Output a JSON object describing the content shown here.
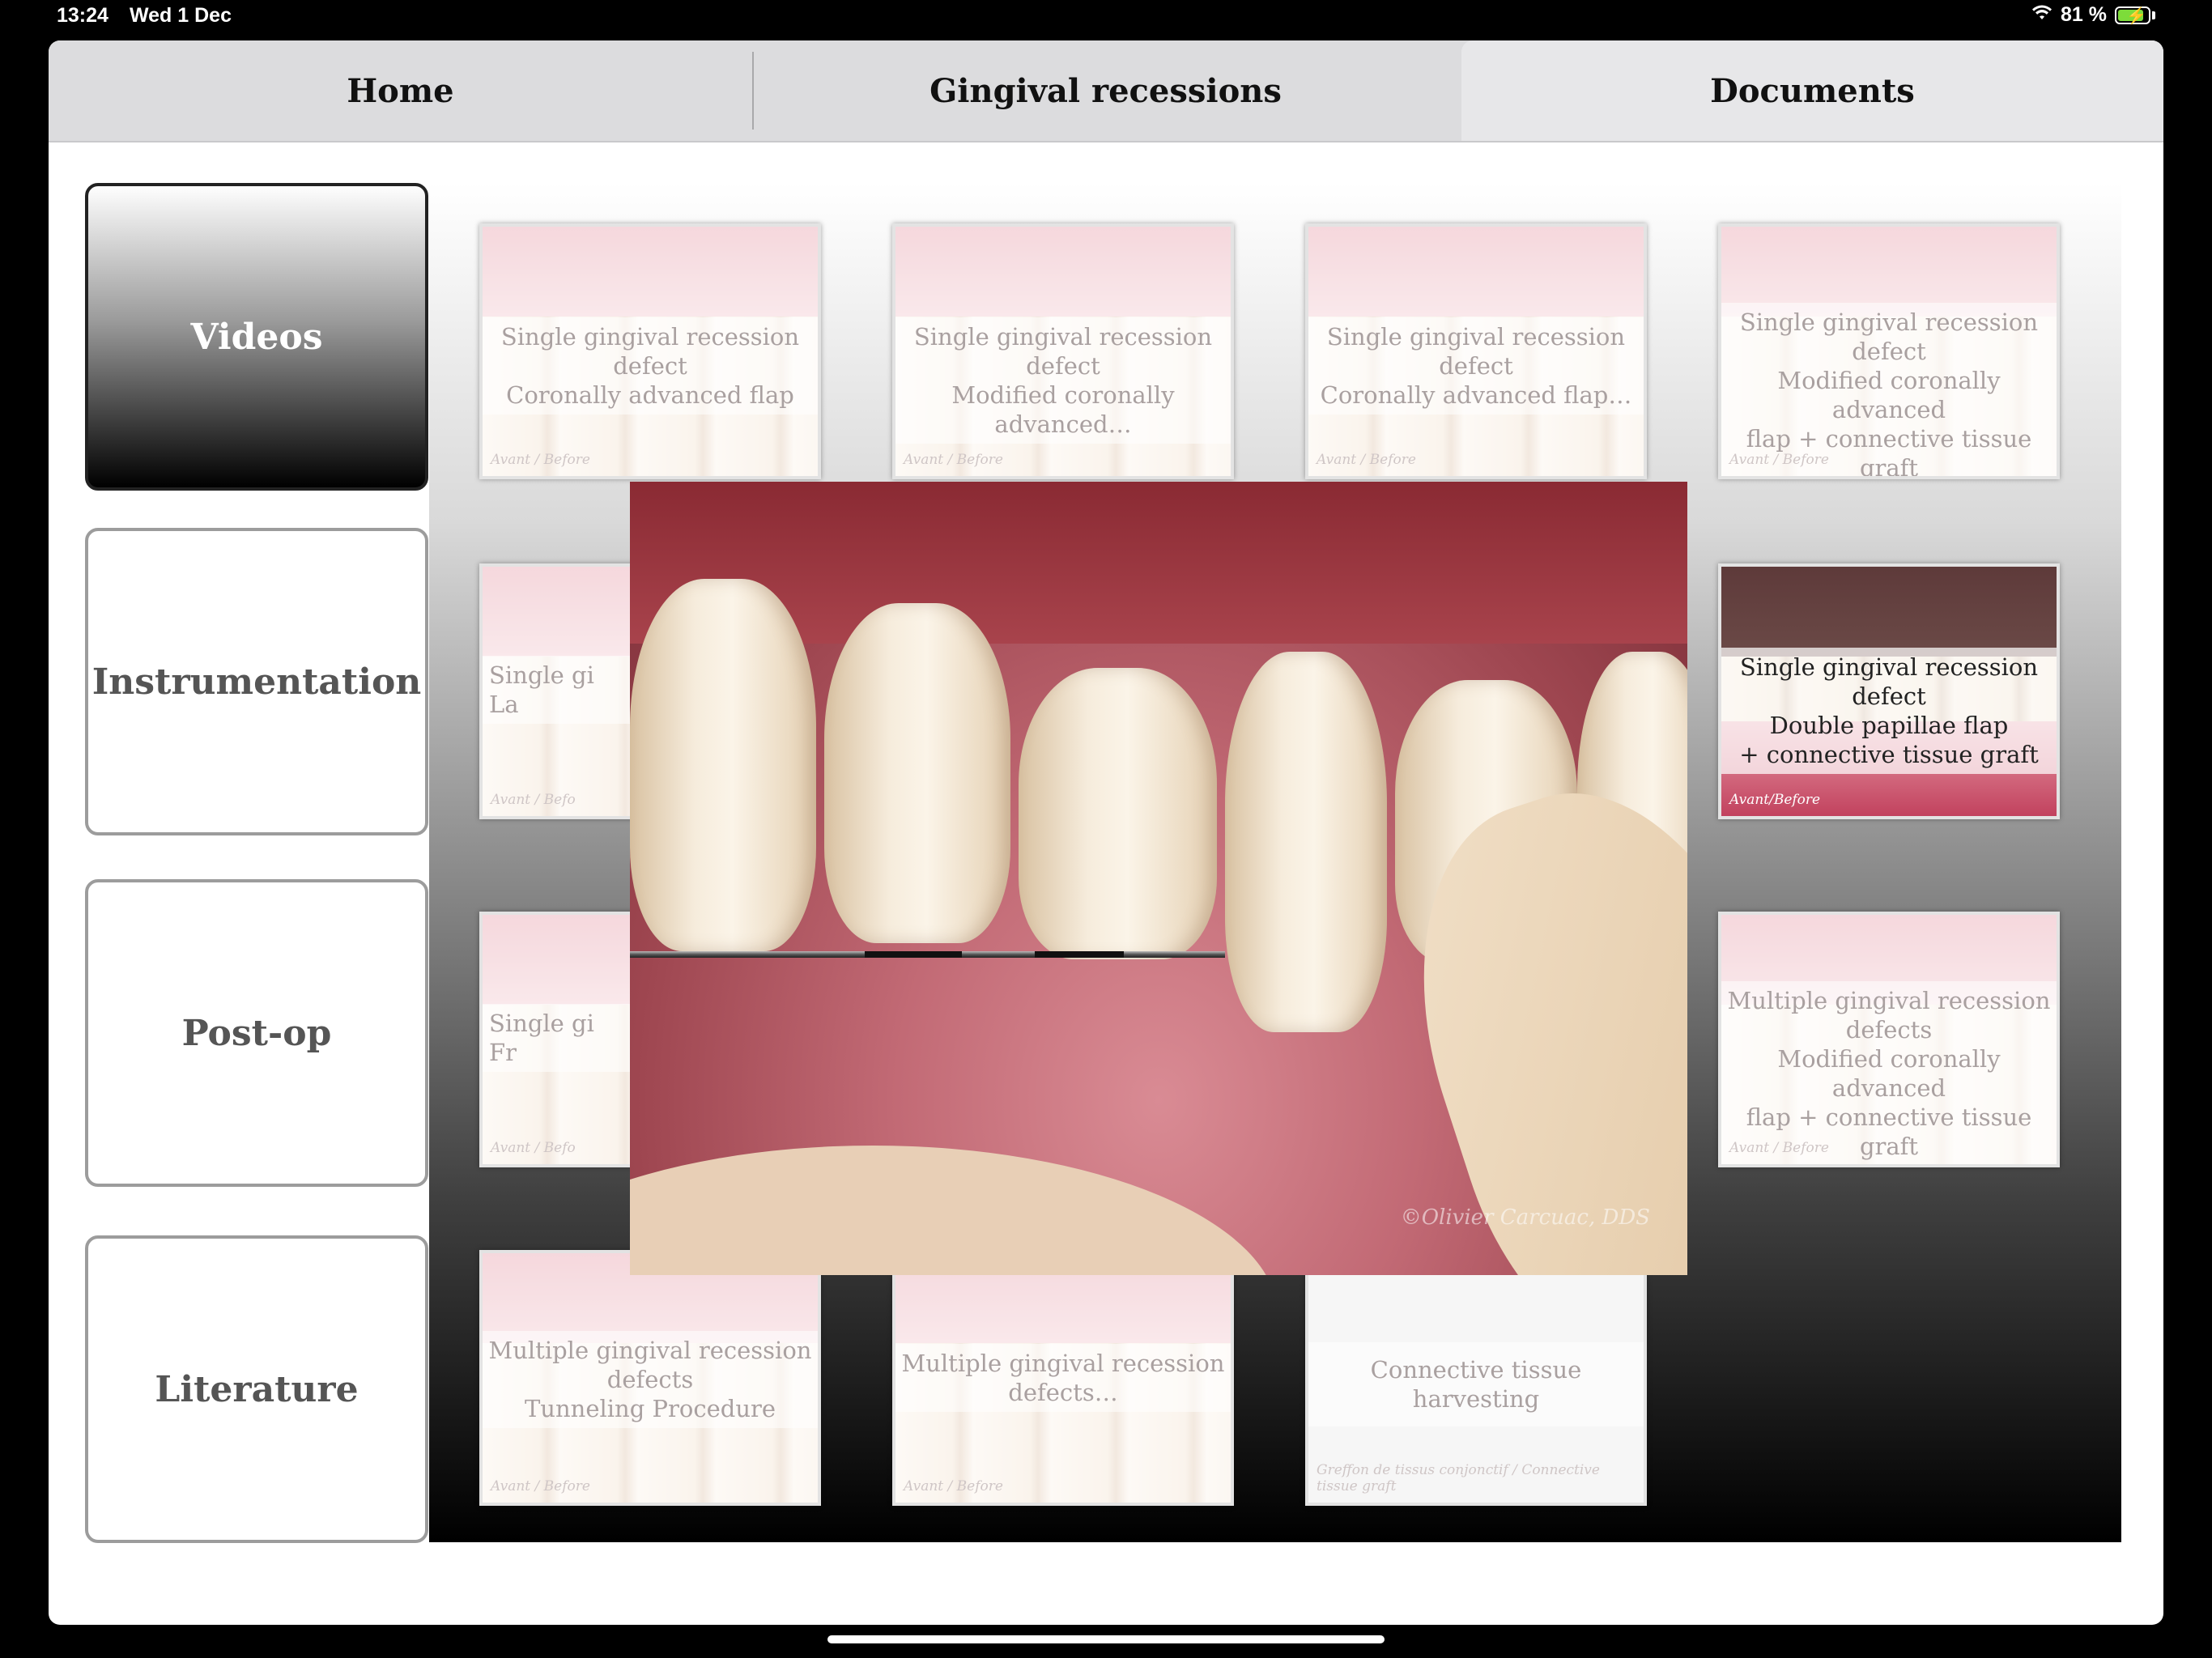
{
  "status_bar": {
    "time": "13:24",
    "date": "Wed 1 Dec",
    "battery": "81 %",
    "battery_level": 0.81
  },
  "tabs": [
    {
      "label": "Home",
      "active": false
    },
    {
      "label": "Gingival recessions",
      "active": false
    },
    {
      "label": "Documents",
      "active": true
    }
  ],
  "sidebar": {
    "items": [
      {
        "label": "Videos",
        "selected": true
      },
      {
        "label": "Instrumentation",
        "selected": false
      },
      {
        "label": "Post-op",
        "selected": false
      },
      {
        "label": "Literature",
        "selected": false
      }
    ]
  },
  "thumbnails": [
    {
      "title": "Single gingival recession defect\nCoronally advanced flap",
      "tag": "Avant / Before"
    },
    {
      "title": "Single gingival recession defect\nModified coronally advanced…",
      "tag": "Avant / Before"
    },
    {
      "title": "Single gingival recession defect\nCoronally advanced flap…",
      "tag": "Avant / Before"
    },
    {
      "title": "Single gingival recession defect\nModified coronally advanced\nflap + connective tissue graft",
      "tag": "Avant / Before"
    },
    {
      "title": "Single gi\nLa",
      "tag": "Avant / Befo"
    },
    {
      "title": "Single gingival recession defect\nDouble papillae flap\n+ connective tissue graft",
      "tag": "Avant/Before"
    },
    {
      "title": "Single gi\nFr",
      "tag": "Avant / Befo"
    },
    {
      "title": "Multiple gingival recession\ndefects\nModified coronally advanced\nflap + connective tissue graft",
      "tag": "Avant / Before"
    },
    {
      "title": "Multiple gingival recession\ndefects\nTunneling Procedure",
      "tag": "Avant / Before"
    },
    {
      "title": "Multiple gingival recession\ndefects…",
      "tag": "Avant / Before"
    },
    {
      "title": "Connective tissue harvesting",
      "tag": "Greffon de tissus conjonctif / Connective tissue graft"
    }
  ],
  "video_player": {
    "watermark": "©Olivier Carcuac, DDS"
  }
}
